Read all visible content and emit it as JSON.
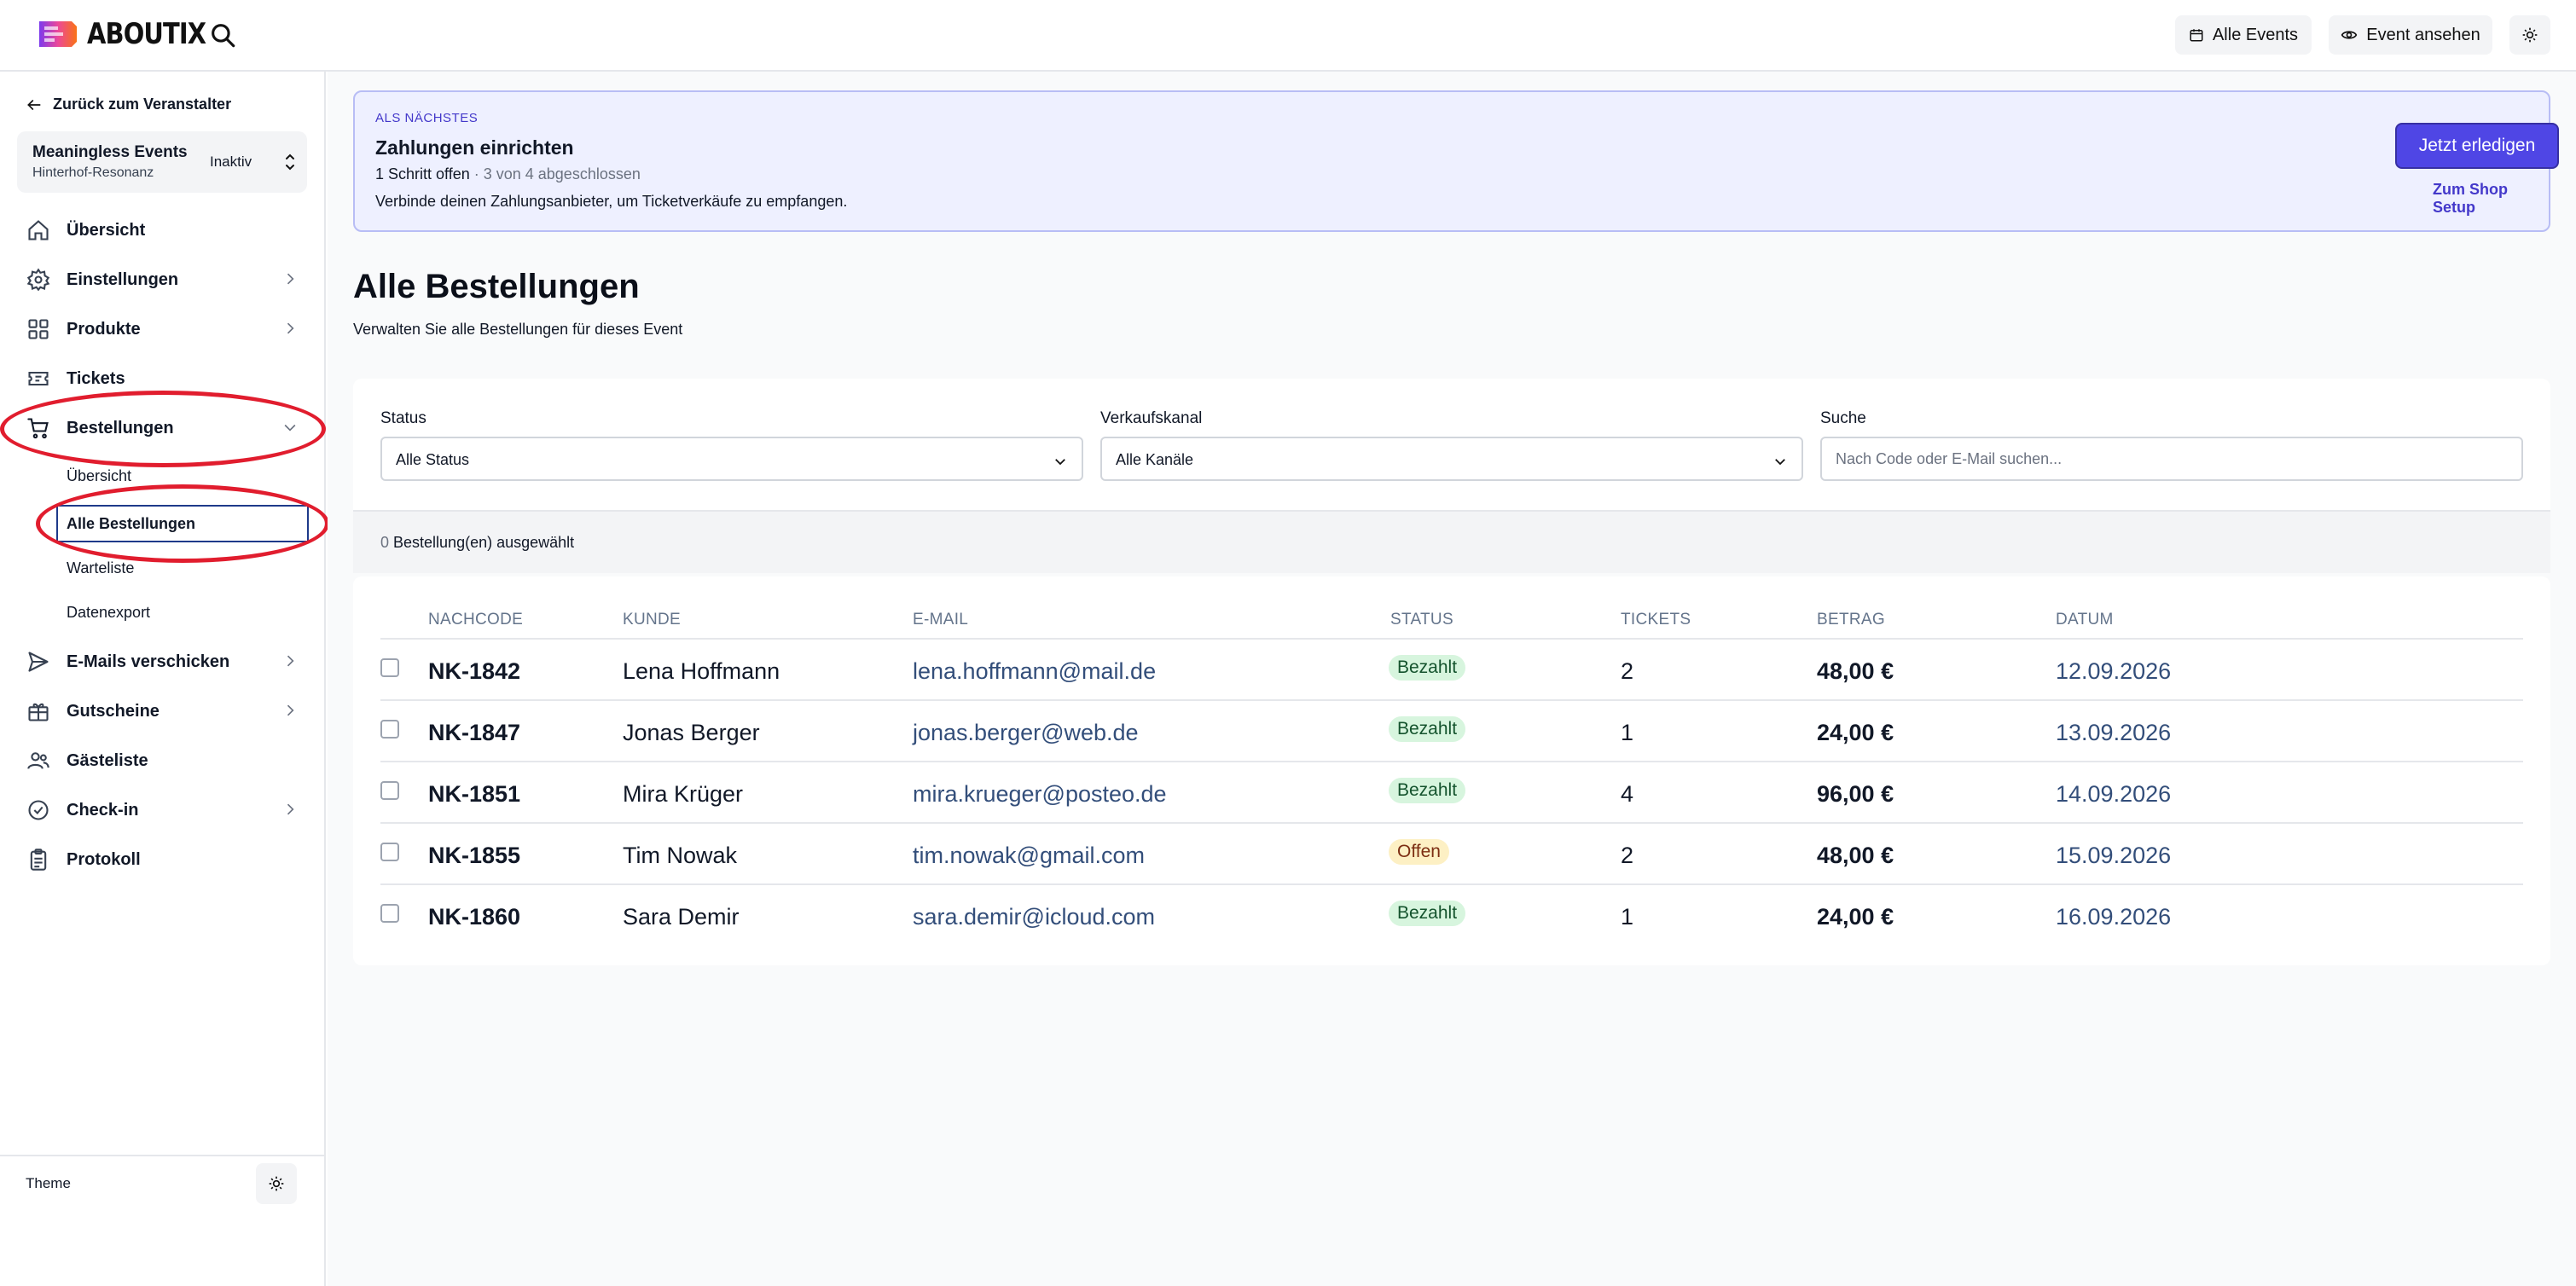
{
  "header": {
    "logo_text": "ABOUTIX",
    "buttons": {
      "all_events": "Alle Events",
      "view_event": "Event ansehen"
    }
  },
  "sidebar": {
    "back_label": "Zurück zum Veranstalter",
    "event": {
      "name": "Meaningless Events",
      "subtitle": "Hinterhof-Resonanz",
      "status": "Inaktiv"
    },
    "nav": {
      "overview": "Übersicht",
      "settings": "Einstellungen",
      "products": "Produkte",
      "tickets": "Tickets",
      "orders": "Bestellungen",
      "emails": "E-Mails verschicken",
      "vouchers": "Gutscheine",
      "guestlist": "Gästeliste",
      "checkin": "Check-in",
      "log": "Protokoll"
    },
    "orders_sub": {
      "overview": "Übersicht",
      "all_orders": "Alle Bestellungen",
      "waitlist": "Warteliste",
      "export": "Datenexport"
    },
    "theme_label": "Theme"
  },
  "banner": {
    "kicker": "ALS NÄCHSTES",
    "title": "Zahlungen einrichten",
    "progress_main": "1 Schritt offen",
    "progress_muted": " · 3 von 4 abgeschlossen",
    "description": "Verbinde deinen Zahlungsanbieter, um Ticketverkäufe zu empfangen.",
    "cta": "Jetzt erledigen",
    "link": "Zum Shop Setup"
  },
  "page": {
    "title": "Alle Bestellungen",
    "subtitle": "Verwalten Sie alle Bestellungen für dieses Event"
  },
  "filters": {
    "status_label": "Status",
    "status_value": "Alle Status",
    "channel_label": "Verkaufskanal",
    "channel_value": "Alle Kanäle",
    "search_label": "Suche",
    "search_placeholder": "Nach Code oder E-Mail suchen...",
    "selected_count": "0",
    "selected_text": " Bestellung(en) ausgewählt"
  },
  "table": {
    "columns": {
      "code": "NACHCODE",
      "customer": "KUNDE",
      "email": "E-MAIL",
      "status": "STATUS",
      "tickets": "TICKETS",
      "amount": "BETRAG",
      "date": "DATUM"
    },
    "rows": [
      {
        "code": "NK-1842",
        "customer": "Lena Hoffmann",
        "email": "lena.hoffmann@mail.de",
        "status": "Bezahlt",
        "tickets": "2",
        "amount": "48,00 €",
        "date": "12.09.2026"
      },
      {
        "code": "NK-1847",
        "customer": "Jonas Berger",
        "email": "jonas.berger@web.de",
        "status": "Bezahlt",
        "tickets": "1",
        "amount": "24,00 €",
        "date": "13.09.2026"
      },
      {
        "code": "NK-1851",
        "customer": "Mira Krüger",
        "email": "mira.krueger@posteo.de",
        "status": "Bezahlt",
        "tickets": "4",
        "amount": "96,00 €",
        "date": "14.09.2026"
      },
      {
        "code": "NK-1855",
        "customer": "Tim Nowak",
        "email": "tim.nowak@gmail.com",
        "status": "Offen",
        "tickets": "2",
        "amount": "48,00 €",
        "date": "15.09.2026"
      },
      {
        "code": "NK-1860",
        "customer": "Sara Demir",
        "email": "sara.demir@icloud.com",
        "status": "Bezahlt",
        "tickets": "1",
        "amount": "24,00 €",
        "date": "16.09.2026"
      }
    ]
  },
  "colors": {
    "accent": "#4f46e5",
    "highlight": "#e11d2e",
    "paid_bg": "#d7f5de",
    "open_bg": "#fdf0c4"
  }
}
